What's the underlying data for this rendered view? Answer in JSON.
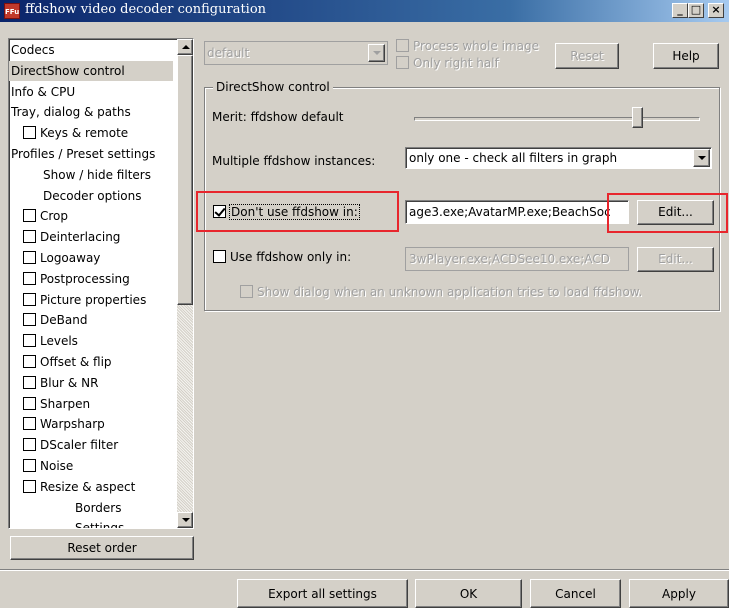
{
  "window": {
    "title": "ffdshow video decoder configuration",
    "app_icon": "FFu",
    "minimize": "_",
    "maximize": "□",
    "close": "×"
  },
  "top_bar": {
    "preset_value": "default",
    "process_whole_image": "Process whole image",
    "only_right_half": "Only right half",
    "reset_label": "Reset",
    "help_label": "Help"
  },
  "tree": {
    "items": [
      {
        "label": "Codecs",
        "indent": 0,
        "checkbox": false
      },
      {
        "label": "DirectShow control",
        "indent": 0,
        "checkbox": false,
        "selected": true
      },
      {
        "label": "Info & CPU",
        "indent": 0,
        "checkbox": false
      },
      {
        "label": "Tray, dialog & paths",
        "indent": 0,
        "checkbox": false
      },
      {
        "label": "Keys & remote",
        "indent": 1,
        "checkbox": true
      },
      {
        "label": "Profiles / Preset settings",
        "indent": 0,
        "checkbox": false
      },
      {
        "label": "Show / hide filters",
        "indent": 2,
        "checkbox": false
      },
      {
        "label": "Decoder options",
        "indent": 2,
        "checkbox": false
      },
      {
        "label": "Crop",
        "indent": 1,
        "checkbox": true
      },
      {
        "label": "Deinterlacing",
        "indent": 1,
        "checkbox": true
      },
      {
        "label": "Logoaway",
        "indent": 1,
        "checkbox": true
      },
      {
        "label": "Postprocessing",
        "indent": 1,
        "checkbox": true
      },
      {
        "label": "Picture properties",
        "indent": 1,
        "checkbox": true
      },
      {
        "label": "DeBand",
        "indent": 1,
        "checkbox": true
      },
      {
        "label": "Levels",
        "indent": 1,
        "checkbox": true
      },
      {
        "label": "Offset & flip",
        "indent": 1,
        "checkbox": true
      },
      {
        "label": "Blur & NR",
        "indent": 1,
        "checkbox": true
      },
      {
        "label": "Sharpen",
        "indent": 1,
        "checkbox": true
      },
      {
        "label": "Warpsharp",
        "indent": 1,
        "checkbox": true
      },
      {
        "label": "DScaler filter",
        "indent": 1,
        "checkbox": true
      },
      {
        "label": "Noise",
        "indent": 1,
        "checkbox": true
      },
      {
        "label": "Resize & aspect",
        "indent": 1,
        "checkbox": true
      },
      {
        "label": "Borders",
        "indent": 3,
        "checkbox": false
      },
      {
        "label": "Settings",
        "indent": 3,
        "checkbox": false
      }
    ],
    "reset_order_label": "Reset order"
  },
  "directshow": {
    "group_title": "DirectShow control",
    "merit_label": "Merit: ffdshow default",
    "merit_level": 0.78,
    "instances_label": "Multiple ffdshow instances:",
    "instances_value": "only one - check all filters in graph",
    "dont_use_label": "Don't use ffdshow in:",
    "dont_use_checked": true,
    "dont_use_value": "age3.exe;AvatarMP.exe;BeachSoc",
    "dont_use_edit": "Edit...",
    "use_only_label": "Use ffdshow only in:",
    "use_only_checked": false,
    "use_only_value": "3wPlayer.exe;ACDSee10.exe;ACD",
    "use_only_edit": "Edit...",
    "show_dialog_label": "Show dialog when an unknown application tries to load ffdshow."
  },
  "bottom": {
    "export_label": "Export all settings",
    "ok_label": "OK",
    "cancel_label": "Cancel",
    "apply_label": "Apply"
  },
  "colors": {
    "highlight_box": "#e8262d",
    "face": "#d4d0c8",
    "title_start": "#0a246a"
  }
}
